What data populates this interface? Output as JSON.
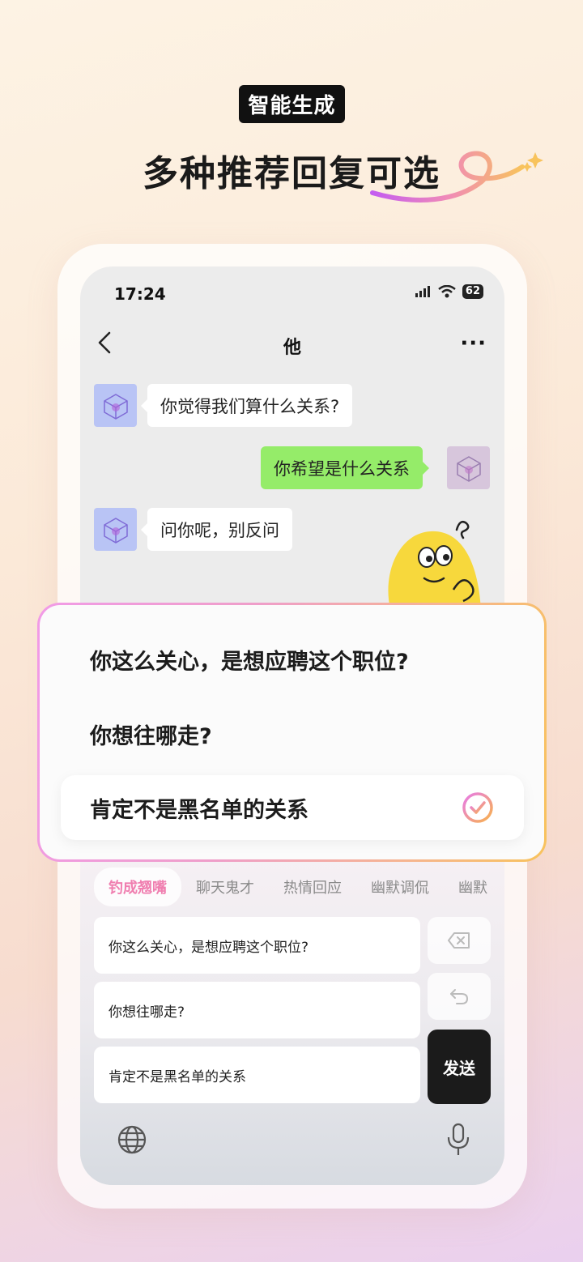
{
  "promo": {
    "badge": "智能生成",
    "title": "多种推荐回复可选"
  },
  "status_bar": {
    "time": "17:24",
    "battery": "62"
  },
  "chat_header": {
    "title": "他"
  },
  "messages": [
    {
      "side": "left",
      "text": "你觉得我们算什么关系?"
    },
    {
      "side": "right",
      "text": "你希望是什么关系"
    },
    {
      "side": "left",
      "text": "问你呢，别反问"
    }
  ],
  "reply_card": {
    "options": [
      {
        "text": "你这么关心，是想应聘这个职位?",
        "selected": false
      },
      {
        "text": "你想往哪走?",
        "selected": false
      },
      {
        "text": "肯定不是黑名单的关系",
        "selected": true
      }
    ]
  },
  "keyboard": {
    "tabs": [
      {
        "label": "钓成翘嘴",
        "active": true
      },
      {
        "label": "聊天鬼才",
        "active": false
      },
      {
        "label": "热情回应",
        "active": false
      },
      {
        "label": "幽默调侃",
        "active": false
      },
      {
        "label": "幽默",
        "active": false
      }
    ],
    "suggestions": [
      "你这么关心，是想应聘这个职位?",
      "你想往哪走?",
      "肯定不是黑名单的关系"
    ],
    "send_label": "发送"
  },
  "colors": {
    "bubble_me": "#95ec69",
    "accent_pink": "#f07fb0",
    "accent_orange": "#f8c35c",
    "send_key": "#1b1b1b"
  }
}
